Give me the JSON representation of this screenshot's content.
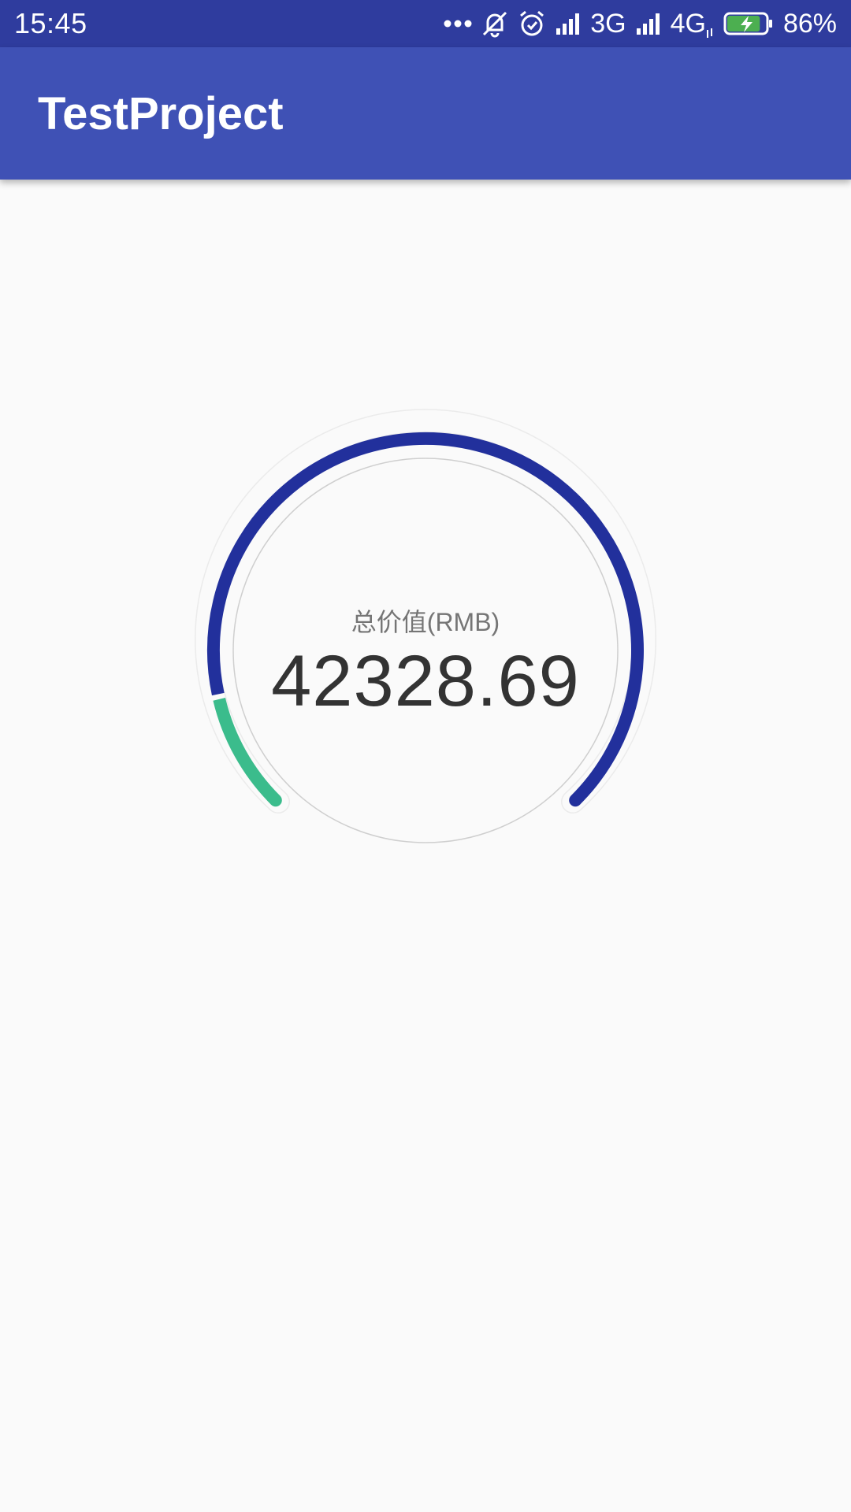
{
  "status_bar": {
    "time": "15:45",
    "network_3g": "3G",
    "network_4g": "4G",
    "battery_percent": "86%",
    "battery_level": 0.86,
    "icons": [
      "more-dots-icon",
      "silent-bell-icon",
      "alarm-icon",
      "signal-icon",
      "signal-icon",
      "data-arrows-icon",
      "battery-charging-icon"
    ]
  },
  "app_bar": {
    "title": "TestProject",
    "color": "#3f51b5"
  },
  "gauge": {
    "label": "总价值(RMB)",
    "value": "42328.69",
    "segments": [
      {
        "color": "#3bbc8c",
        "fraction": 0.12
      },
      {
        "color": "#22309c",
        "fraction": 0.88
      }
    ]
  }
}
